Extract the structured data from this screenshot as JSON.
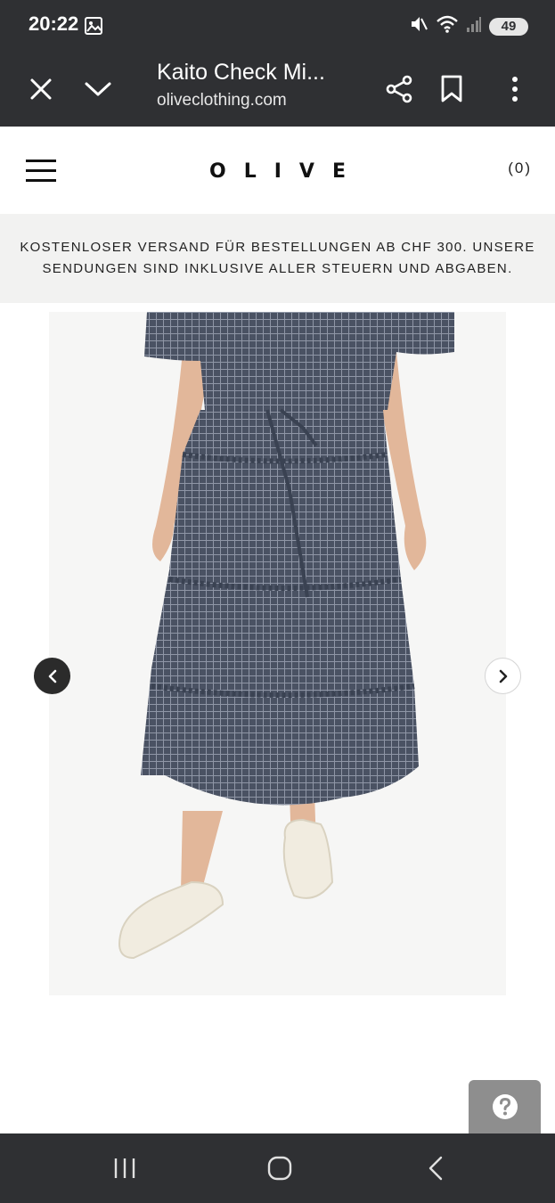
{
  "status_bar": {
    "time": "20:22",
    "battery": "49",
    "icons": [
      "gallery-icon",
      "mute-icon",
      "wifi-icon",
      "signal-icon",
      "battery-icon"
    ]
  },
  "browser": {
    "page_title": "Kaito Check Mi...",
    "url": "oliveclothing.com",
    "icons": [
      "close-icon",
      "chevron-down-icon",
      "share-icon",
      "bookmark-icon",
      "more-vert-icon"
    ]
  },
  "site": {
    "logo": "OLIVE",
    "cart_count": "(0)",
    "menu_icon": "hamburger-menu-icon"
  },
  "banner": {
    "line1": "KOSTENLOSER VERSAND FÜR BESTELLUNGEN AB CHF 300. UNSERE",
    "line2": "SENDUNGEN SIND INKLUSIVE ALLER STEUERN UND ABGABEN."
  },
  "carousel": {
    "prev_icon": "chevron-left-icon",
    "next_icon": "chevron-right-icon"
  },
  "help": {
    "icon": "question-icon"
  },
  "nav_bar": {
    "icons": [
      "recent-apps-icon",
      "home-icon",
      "back-icon"
    ]
  },
  "colors": {
    "chrome": "#2f3033",
    "banner_bg": "#f2f2f1",
    "skirt": "#4a5263",
    "help_bg": "#8e8e8e"
  }
}
